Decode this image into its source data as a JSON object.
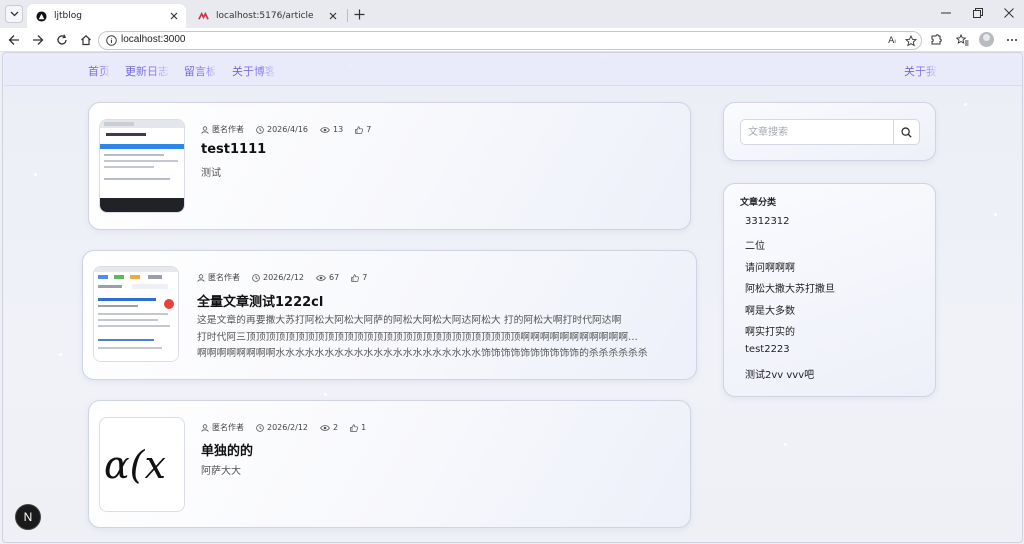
{
  "browser": {
    "tabs": [
      {
        "title": "ljtblog",
        "active": true
      },
      {
        "title": "localhost:5176/article",
        "active": false
      }
    ],
    "url": "localhost:3000"
  },
  "nav": {
    "links": [
      "首页",
      "更新日志",
      "留言板",
      "关于博客"
    ],
    "right_link": "关于我"
  },
  "articles": [
    {
      "author": "匿名作者",
      "date": "2026/4/16",
      "views": "13",
      "likes": "7",
      "title": "test1111",
      "excerpt": "测试"
    },
    {
      "author": "匿名作者",
      "date": "2026/2/12",
      "views": "67",
      "likes": "7",
      "title": "全量文章测试1222cl",
      "excerpt_lines": [
        "这是文章的再要撒大苏打阿松大阿松大阿萨的阿松大阿松大阿达阿松大 打的阿松大啊打时代阿达啊",
        "打时代阿三顶顶顶顶顶顶顶顶顶顶顶顶顶顶顶顶顶顶顶顶顶顶顶顶顶顶顶顶啊啊啊啊啊啊啊啊啊啊啊…",
        "啊啊啊啊啊啊啊啊水水水水水水水水水水水水水水水水水水水水水饰饰饰饰饰饰饰饰饰饰的杀杀杀杀杀杀"
      ]
    },
    {
      "author": "匿名作者",
      "date": "2026/2/12",
      "views": "2",
      "likes": "1",
      "title": "单独的的",
      "excerpt": "阿萨大大",
      "thumb_formula": "α(x"
    }
  ],
  "sidebar": {
    "search_placeholder": "文章搜索",
    "categories_title": "文章分类",
    "categories": [
      "3312312",
      "二位",
      "请问啊啊啊",
      "阿松大撒大苏打撒旦",
      "啊是大多数",
      "啊实打实的",
      "test2223",
      "测试2vv vvv吧"
    ]
  },
  "badge": "N",
  "colors": {
    "nav_accent": "#6a5ce0",
    "page_bg": "#eef0f6"
  }
}
